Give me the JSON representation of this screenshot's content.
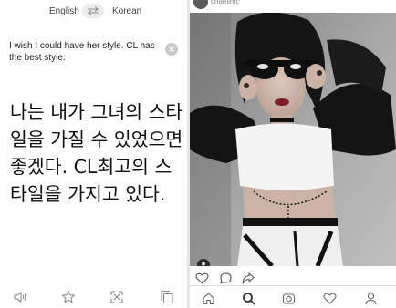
{
  "translator": {
    "source_language": "English",
    "target_language": "Korean",
    "source_text": "I wish I could have her style. CL has the best style.",
    "translation": "나는 내가 그녀의 스타일을 가질 수 있었으면 좋겠다. CL최고의 스타일을 가지고 있다.",
    "toolbar_icons": [
      "speaker-icon",
      "star-icon",
      "expand-icon",
      "copy-icon"
    ]
  },
  "post": {
    "username": "chaelimc",
    "action_icons": [
      "heart-icon",
      "comment-icon",
      "share-icon"
    ],
    "nav_icons": [
      "home-icon",
      "search-icon",
      "camera-icon",
      "activity-icon",
      "profile-icon"
    ]
  },
  "colors": {
    "icon_gray": "#8a8a8a",
    "panel_background": "#ffffff",
    "divider": "#e6e6e6"
  }
}
